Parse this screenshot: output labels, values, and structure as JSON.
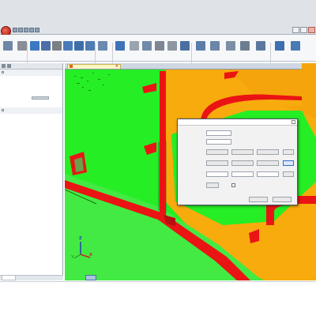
{
  "window": {
    "title": ""
  },
  "ribbon": {
    "tabs": [
      "",
      "",
      "",
      "",
      "",
      "",
      ""
    ],
    "tools": [
      {
        "name": "file-icon",
        "color": "#6d87a6"
      },
      {
        "name": "pencil-icon",
        "color": "#8a8f96"
      },
      {
        "name": "rotate-icon",
        "color": "#3a78c2"
      },
      {
        "name": "section-icon",
        "color": "#4d6eaa"
      },
      {
        "name": "cursor-icon",
        "color": "#7b7f86"
      },
      {
        "name": "pan-icon",
        "color": "#4a7bb8"
      },
      {
        "name": "zoom-icon",
        "color": "#3e6ea8"
      },
      {
        "name": "fit-view-icon",
        "color": "#4f7cb2"
      },
      {
        "name": "select-icon",
        "color": "#6a8ab0"
      },
      {
        "name": "monitor-icon",
        "color": "#3e73b8"
      },
      {
        "name": "delete-icon",
        "color": "#9aa3ae"
      },
      {
        "name": "measure-icon",
        "color": "#6f8aab"
      },
      {
        "name": "cut-icon",
        "color": "#7d8590"
      },
      {
        "name": "hide-icon",
        "color": "#8d96a1"
      },
      {
        "name": "layer-icon",
        "color": "#4b6fa3"
      },
      {
        "name": "grid-icon",
        "color": "#5a7daa"
      },
      {
        "name": "align-icon",
        "color": "#6b86a8"
      },
      {
        "name": "edit-icon",
        "color": "#7c8ea5"
      },
      {
        "name": "settings-icon",
        "color": "#6d7d91"
      },
      {
        "name": "export-icon",
        "color": "#5b79a0"
      },
      {
        "name": "view-icon",
        "color": "#3e6fae"
      },
      {
        "name": "render-icon",
        "color": "#4a7ab4"
      }
    ]
  },
  "left_panel": {
    "rows": [
      {
        "type": "section"
      },
      {
        "type": "item",
        "value": true
      },
      {
        "type": "item",
        "value": true
      },
      {
        "type": "item",
        "value": true
      },
      {
        "type": "item",
        "bar": true
      },
      {
        "type": "item",
        "value": true
      },
      {
        "type": "section"
      },
      {
        "type": "item",
        "value": true
      },
      {
        "type": "item"
      },
      {
        "type": "item",
        "value": true
      },
      {
        "type": "item"
      },
      {
        "type": "item"
      },
      {
        "type": "item"
      },
      {
        "type": "item"
      }
    ],
    "bottom_tabs": [
      "",
      "",
      ""
    ]
  },
  "viewport": {
    "doc_tab": {
      "title": "",
      "close": "×"
    },
    "axes": {
      "x": "X",
      "y": "Y",
      "z": "Z"
    },
    "colors": {
      "background": "#25ee25",
      "plate": "#f7ab0d",
      "weld": "#ea1414",
      "panel": "#25ee25"
    }
  },
  "dialog": {
    "title": "",
    "fields": [
      {
        "label": "",
        "value": "",
        "unit": ""
      },
      {
        "label": "",
        "value": "",
        "unit": ""
      }
    ],
    "coord_rows": [
      {
        "label": "",
        "a": "",
        "b": "",
        "c": "",
        "button": ""
      },
      {
        "label": "",
        "a": "",
        "b": "",
        "c": "",
        "button": ""
      },
      {
        "label": "",
        "a": "",
        "b": "",
        "c": "",
        "button": ""
      }
    ],
    "rotation": {
      "label": "",
      "value": "",
      "unit": ""
    },
    "checkbox_label": "",
    "ok": "",
    "cancel": ""
  }
}
